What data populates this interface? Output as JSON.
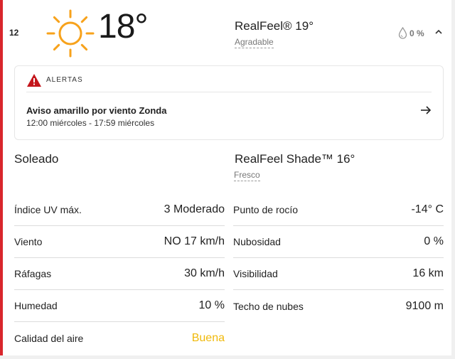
{
  "header": {
    "hour": "12",
    "weather_icon": "sun-icon",
    "temperature": "18°",
    "realfeel": "RealFeel® 19°",
    "realfeel_desc": "Agradable",
    "precip_icon": "drop-icon",
    "precip": "0 %",
    "collapse_icon": "chevron-up-icon"
  },
  "alert": {
    "icon": "warning-icon",
    "title": "ALERTAS",
    "name": "Aviso amarillo por viento Zonda",
    "time": "12:00 miércoles - 17:59 miércoles",
    "arrow_icon": "arrow-right-icon",
    "accent_color": "#d9262c"
  },
  "conditions": {
    "summary": "Soleado",
    "realfeel_shade": "RealFeel Shade™ 16°",
    "realfeel_shade_desc": "Fresco"
  },
  "details_left": [
    {
      "label": "Índice UV máx.",
      "value": "3 Moderado"
    },
    {
      "label": "Viento",
      "value": "NO 17 km/h"
    },
    {
      "label": "Ráfagas",
      "value": "30 km/h"
    },
    {
      "label": "Humedad",
      "value": "10 %"
    },
    {
      "label": "Calidad del aire",
      "value": "Buena"
    }
  ],
  "details_right": [
    {
      "label": "Punto de rocío",
      "value": "-14° C"
    },
    {
      "label": "Nubosidad",
      "value": "0 %"
    },
    {
      "label": "Visibilidad",
      "value": "16 km"
    },
    {
      "label": "Techo de nubes",
      "value": "9100 m"
    }
  ],
  "colors": {
    "accent": "#d9262c",
    "sun": "#f7a21b",
    "air_quality_good": "#f0b90a"
  }
}
